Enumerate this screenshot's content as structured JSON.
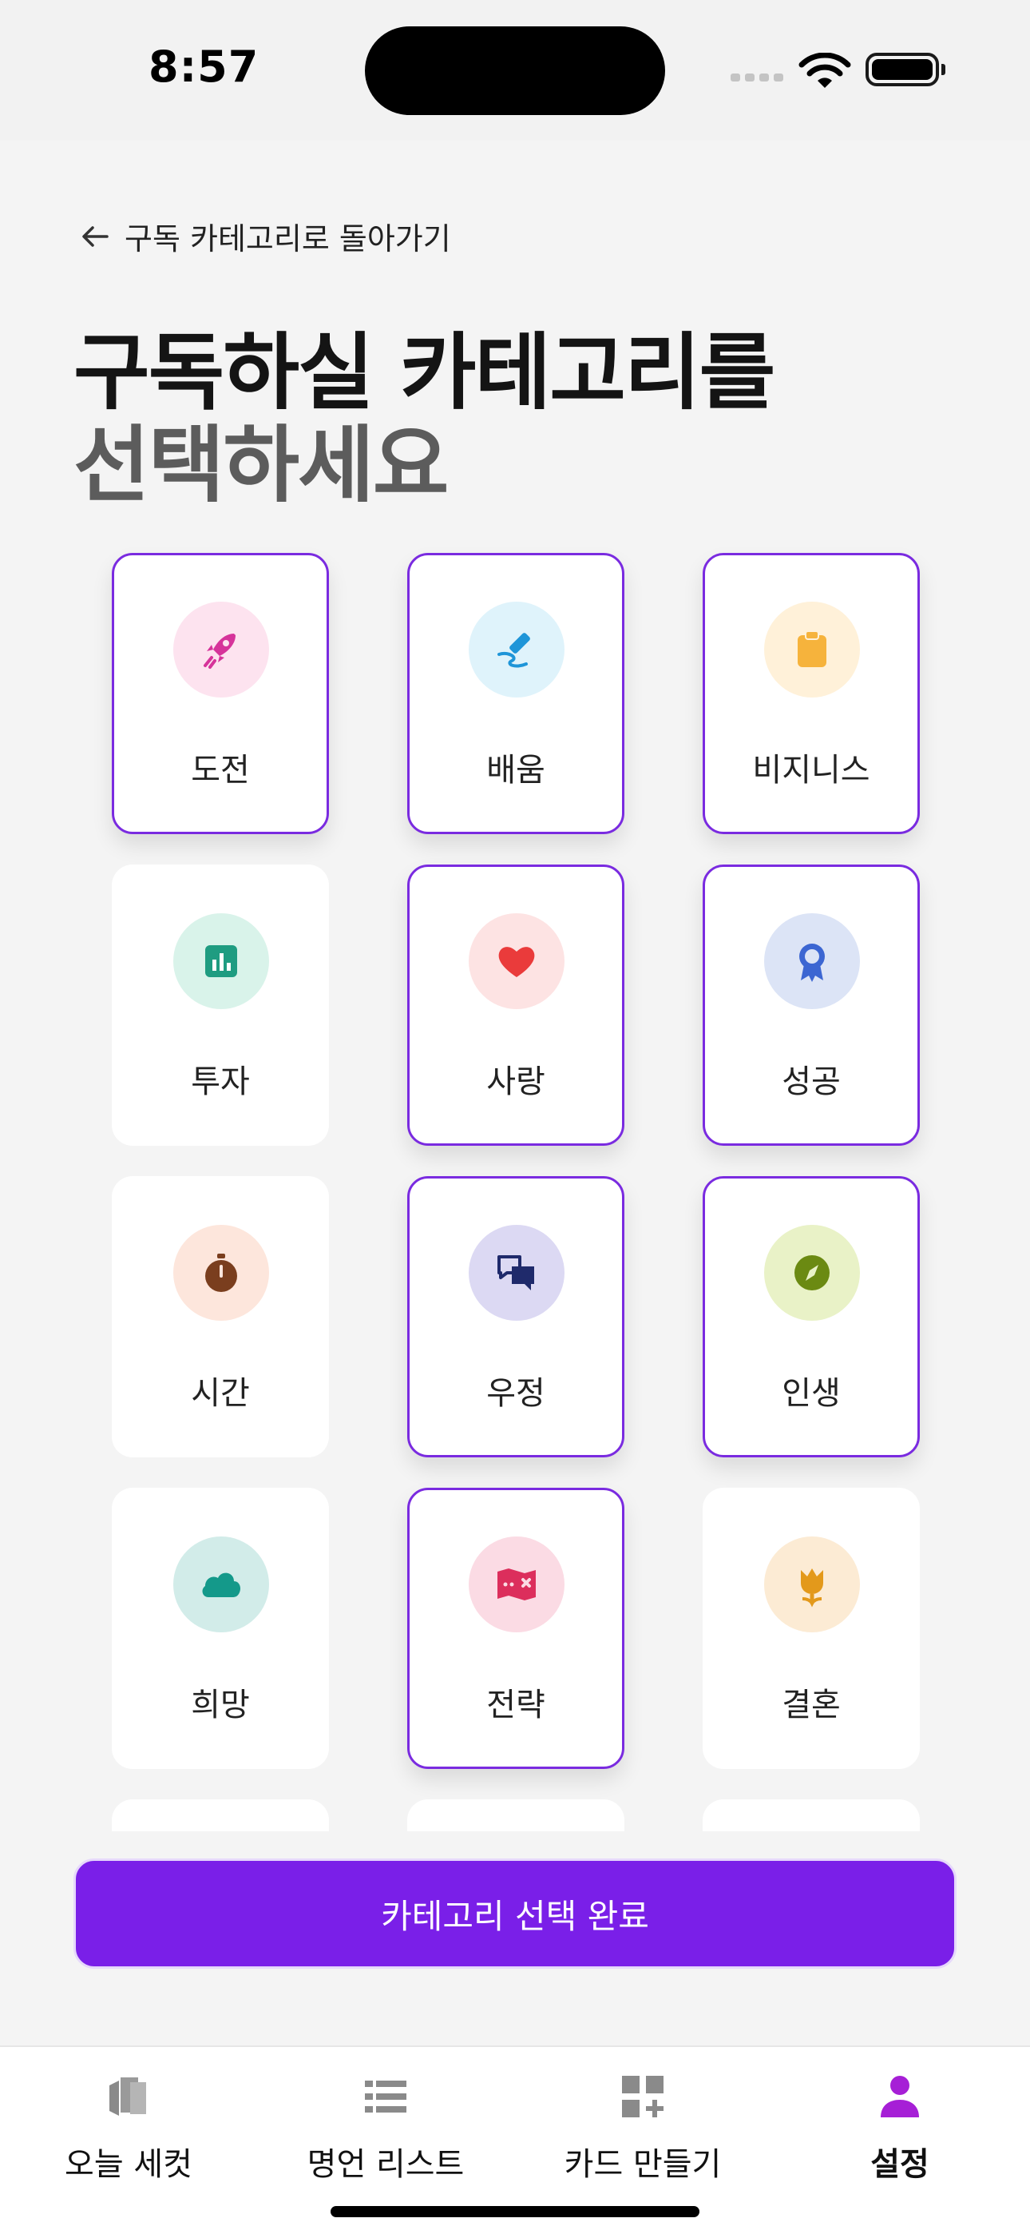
{
  "status_bar": {
    "time": "8:57"
  },
  "back_link": {
    "label": "구독 카테고리로 돌아가기"
  },
  "heading": {
    "line1": "구독하실 카테고리를",
    "line2": "선택하세요"
  },
  "categories": [
    {
      "label": "도전",
      "icon": "rocket-icon",
      "selected": true,
      "bg": "#fde3ef",
      "color": "#d6339a"
    },
    {
      "label": "배움",
      "icon": "pen-icon",
      "selected": true,
      "bg": "#dff3fb",
      "color": "#1e95d8"
    },
    {
      "label": "비지니스",
      "icon": "clipboard-icon",
      "selected": true,
      "bg": "#fff1d9",
      "color": "#f6b33c"
    },
    {
      "label": "투자",
      "icon": "chart-icon",
      "selected": false,
      "bg": "#d9f3ea",
      "color": "#1f9c81"
    },
    {
      "label": "사랑",
      "icon": "heart-icon",
      "selected": true,
      "bg": "#fde3e3",
      "color": "#ea3b3b"
    },
    {
      "label": "성공",
      "icon": "medal-icon",
      "selected": true,
      "bg": "#dce4f6",
      "color": "#3c66d2"
    },
    {
      "label": "시간",
      "icon": "stopwatch-icon",
      "selected": false,
      "bg": "#fde6dc",
      "color": "#7a3e1e"
    },
    {
      "label": "우정",
      "icon": "chat-icon",
      "selected": true,
      "bg": "#dcd9f3",
      "color": "#1f2a6b"
    },
    {
      "label": "인생",
      "icon": "compass-icon",
      "selected": true,
      "bg": "#e9f2c7",
      "color": "#6b8a12"
    },
    {
      "label": "희망",
      "icon": "cloud-icon",
      "selected": false,
      "bg": "#d2ece9",
      "color": "#14998a"
    },
    {
      "label": "전략",
      "icon": "map-icon",
      "selected": true,
      "bg": "#fbdbe4",
      "color": "#dc2e5c"
    },
    {
      "label": "결혼",
      "icon": "tulip-icon",
      "selected": false,
      "bg": "#fcebd4",
      "color": "#e3991b"
    }
  ],
  "complete_button": {
    "label": "카테고리 선택 완료"
  },
  "tabs": [
    {
      "label": "오늘 세컷",
      "icon": "cards-icon",
      "active": false
    },
    {
      "label": "명언 리스트",
      "icon": "list-icon",
      "active": false
    },
    {
      "label": "카드 만들기",
      "icon": "add-grid-icon",
      "active": false
    },
    {
      "label": "설정",
      "icon": "person-icon",
      "active": true
    }
  ],
  "colors": {
    "accent": "#7a1fe8",
    "active_tab": "#a61fd6",
    "inactive_tab": "#8a8a8a"
  }
}
